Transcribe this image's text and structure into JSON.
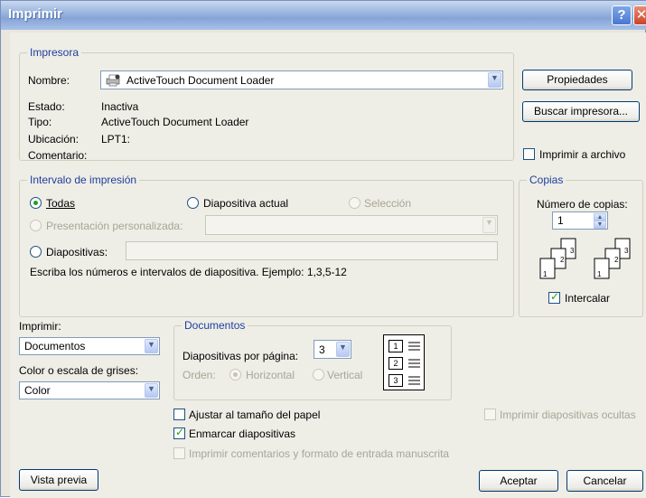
{
  "window": {
    "title": "Imprimir",
    "help_glyph": "?",
    "close_glyph": "✕"
  },
  "printer": {
    "legend": "Impresora",
    "name_label": "Nombre:",
    "name_value": "ActiveTouch Document Loader",
    "status_label": "Estado:",
    "status_value": "Inactiva",
    "type_label": "Tipo:",
    "type_value": "ActiveTouch Document Loader",
    "location_label": "Ubicación:",
    "location_value": "LPT1:",
    "comment_label": "Comentario:",
    "properties_button": "Propiedades",
    "find_printer_button": "Buscar impresora...",
    "print_to_file_label": "Imprimir a archivo",
    "print_to_file_checked": false
  },
  "range": {
    "legend": "Intervalo de impresión",
    "all_label": "Todas",
    "all_selected": true,
    "current_slide_label": "Diapositiva actual",
    "selection_label": "Selección",
    "custom_show_label": "Presentación personalizada:",
    "slides_label": "Diapositivas:",
    "slides_value": "",
    "hint": "Escriba los números e intervalos de diapositiva. Ejemplo: 1,3,5-12"
  },
  "copies": {
    "legend": "Copias",
    "count_label": "Número de copias:",
    "count_value": "1",
    "collate_label": "Intercalar",
    "collate_checked": true
  },
  "print_what": {
    "label": "Imprimir:",
    "value": "Documentos"
  },
  "color": {
    "label": "Color o escala de grises:",
    "value": "Color"
  },
  "handouts": {
    "legend": "Documentos",
    "per_page_label": "Diapositivas por página:",
    "per_page_value": "3",
    "order_label": "Orden:",
    "horizontal_label": "Horizontal",
    "vertical_label": "Vertical",
    "preview_numbers": [
      "1",
      "2",
      "3"
    ]
  },
  "options": {
    "fit_label": "Ajustar al tamaño del papel",
    "fit_checked": false,
    "frame_label": "Enmarcar diapositivas",
    "frame_checked": true,
    "comments_label": "Imprimir comentarios y formato de entrada manuscrita",
    "hidden_label": "Imprimir diapositivas ocultas"
  },
  "footer": {
    "preview_button": "Vista previa",
    "ok_button": "Aceptar",
    "cancel_button": "Cancelar"
  },
  "colors": {
    "title_gradient_mid": "#86a4d6",
    "legend_text": "#1e3f9e",
    "check_green": "#21a121",
    "dialog_bg": "#eeede6"
  }
}
